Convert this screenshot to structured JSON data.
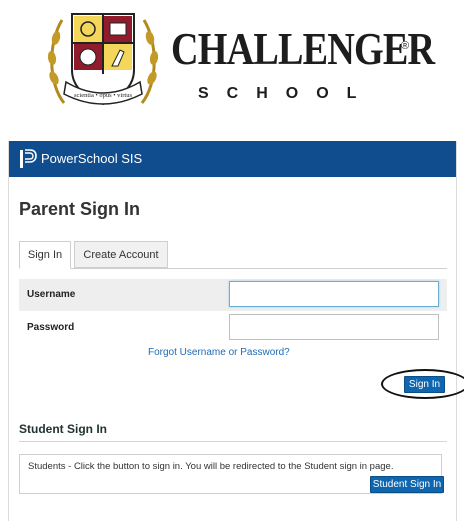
{
  "school": {
    "name": "CHALLENGER",
    "registered_mark": "®",
    "subtitle": "SCHOOL",
    "motto": "scientia • opus • virtus"
  },
  "app": {
    "title": "PowerSchool SIS"
  },
  "page": {
    "title": "Parent Sign In"
  },
  "tabs": [
    {
      "label": "Sign In",
      "active": true
    },
    {
      "label": "Create Account",
      "active": false
    }
  ],
  "form": {
    "username_label": "Username",
    "username_value": "",
    "password_label": "Password",
    "password_value": "",
    "forgot_link": "Forgot Username or Password?",
    "signin_button": "Sign In"
  },
  "student": {
    "title": "Student Sign In",
    "message": "Students - Click the button to sign in. You will be redirected to the Student sign in page.",
    "button": "Student Sign In"
  },
  "colors": {
    "header_bar": "#0f4d8f",
    "button": "#0f66ae",
    "link": "#1f6bb8"
  }
}
